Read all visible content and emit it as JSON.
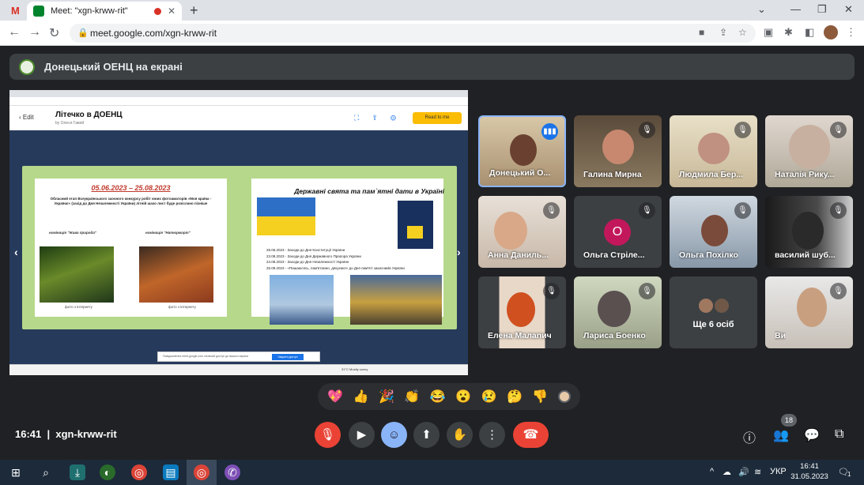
{
  "browser": {
    "tab_title": "Meet: \"xgn-krww-rit\"",
    "gmail_label": "M",
    "url": "meet.google.com/xgn-krww-rit"
  },
  "banner": {
    "text": "Донецький ОЕНЦ на екрані"
  },
  "shared_screen": {
    "edit": "Edit",
    "title": "Літечко в ДОЕНЦ",
    "byline": "by Олеся Гавей",
    "read_btn": "Read to me",
    "page1": {
      "date": "05.06.2023 – 25.08.2023",
      "desc": "Обласний етап Всеукраїнського заочного конкурсу робіт юних фотоаматорів «Моя країна - Україна!» (захід до Дня Незалежності України) літній шахо лист буде розіслано пізніше",
      "label_left": "номінація \"Жива природа\"",
      "label_right": "номінація \"Натюрморт\"",
      "cap_left": "фото з інтернету",
      "cap_right": "фото з інтернету"
    },
    "page2": {
      "heading": "Державні свята та пам`ятні дати в Україні",
      "lines": [
        "28.06.2023 - Заходи до Дня Конституції України",
        "23.08.2023 - Заходи до Дня Державного Прапора України",
        "24.08.2023 - Заходи до Дня Незалежності України",
        "25.08.2023 - «Пишаюсясь, пам'ятаємо, дякуємо!» до Дня пам'яті захисників України"
      ]
    },
    "bottom_note": "Повідомлення meet.google.com спільний доступ до вашого екрана",
    "bottom_btn": "Закрити доступ",
    "taskbar_weather": "31°C Mostly sunny"
  },
  "participants": [
    {
      "name": "Донецький О...",
      "state": "speaking"
    },
    {
      "name": "Галина Мирна",
      "state": "muted"
    },
    {
      "name": "Людмила Бер...",
      "state": "muted"
    },
    {
      "name": "Наталія Рику...",
      "state": "muted"
    },
    {
      "name": "Анна Даниль...",
      "state": "muted"
    },
    {
      "name": "Ольга Стріле...",
      "state": "muted",
      "initial": "О"
    },
    {
      "name": "Ольга Похілко",
      "state": "muted"
    },
    {
      "name": "василий шуб...",
      "state": "muted"
    },
    {
      "name": "Елена Малanич",
      "state": "muted"
    },
    {
      "name": "Лариса Боенко",
      "state": "muted"
    },
    {
      "name": "Ще 6 осіб",
      "state": "more"
    },
    {
      "name": "Ви",
      "state": "muted"
    }
  ],
  "reactions": [
    "💖",
    "👍",
    "🎉",
    "👏",
    "😂",
    "😮",
    "😢",
    "🤔",
    "👎"
  ],
  "meetbar": {
    "time": "16:41",
    "separator": "|",
    "code": "xgn-krww-rit",
    "participants_badge": "18"
  },
  "taskbar": {
    "lang": "УКР",
    "time": "16:41",
    "date": "31.05.2023",
    "notif": "1"
  }
}
